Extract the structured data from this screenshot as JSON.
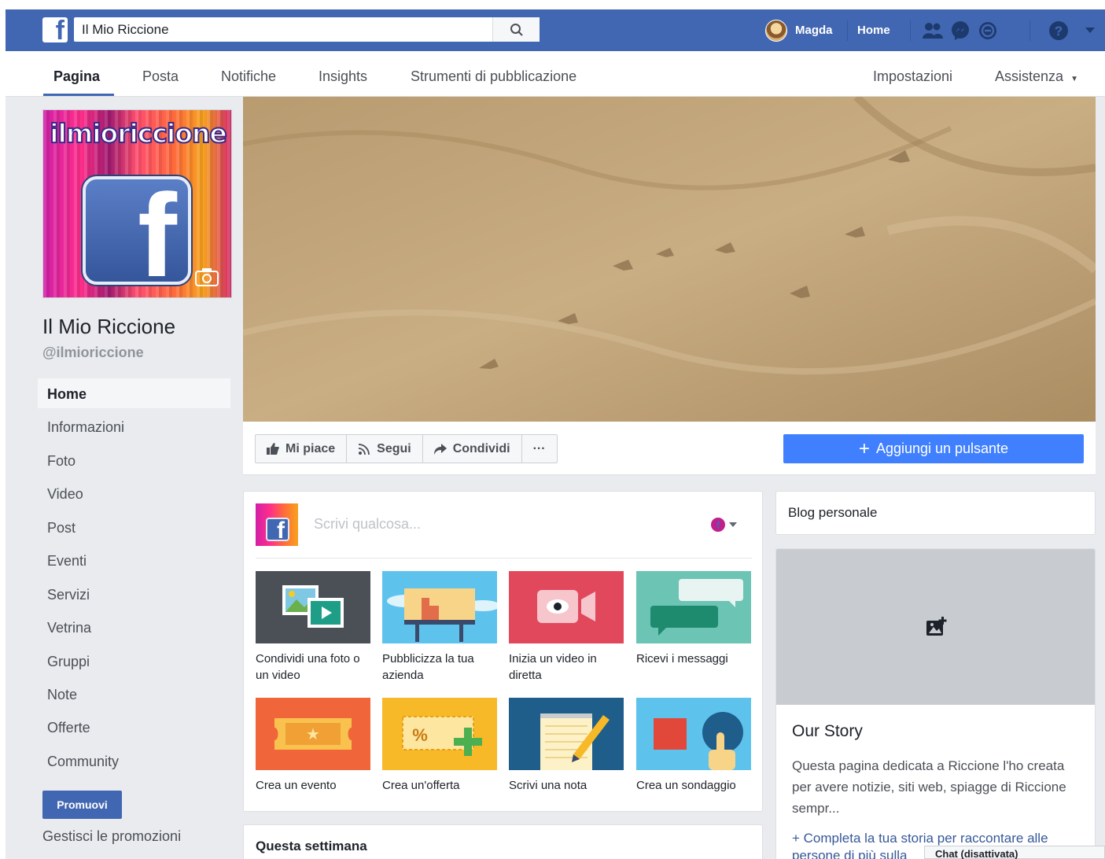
{
  "topbar": {
    "search_value": "Il Mio Riccione",
    "user_name": "Magda",
    "home_label": "Home"
  },
  "subnav": {
    "tabs": [
      "Pagina",
      "Posta",
      "Notifiche",
      "Insights",
      "Strumenti di pubblicazione"
    ],
    "settings_label": "Impostazioni",
    "help_label": "Assistenza"
  },
  "profile": {
    "brand_text": "ilmioriccione",
    "name": "Il Mio Riccione",
    "handle": "@ilmioriccione"
  },
  "leftnav": {
    "items": [
      "Home",
      "Informazioni",
      "Foto",
      "Video",
      "Post",
      "Eventi",
      "Servizi",
      "Vetrina",
      "Gruppi",
      "Note",
      "Offerte",
      "Community"
    ],
    "promote_label": "Promuovi",
    "manage_promotions_label": "Gestisci le promozioni"
  },
  "actions": {
    "like_label": "Mi piace",
    "follow_label": "Segui",
    "share_label": "Condividi",
    "more_label": "···",
    "add_button_label": "Aggiungi un pulsante"
  },
  "composer": {
    "placeholder": "Scrivi qualcosa...",
    "tiles": [
      {
        "label": "Condividi una foto o un video"
      },
      {
        "label": "Pubblicizza la tua azienda"
      },
      {
        "label": "Inizia un video in diretta"
      },
      {
        "label": "Ricevi i messaggi"
      },
      {
        "label": "Crea un evento"
      },
      {
        "label": "Crea un'offerta"
      },
      {
        "label": "Scrivi una nota"
      },
      {
        "label": "Crea un sondaggio"
      }
    ]
  },
  "this_week": {
    "title": "Questa settimana"
  },
  "right": {
    "blog_title": "Blog personale",
    "story_title": "Our Story",
    "story_text": "Questa pagina dedicata a Riccione l'ho creata per avere notizie, siti web, spiagge di Riccione sempr...",
    "story_link": "+ Completa la tua storia per raccontare alle persone di più sulla"
  },
  "chat": {
    "label": "Chat (disattivata)"
  },
  "colors": {
    "brand": "#4267b2",
    "accent": "#4080ff",
    "background": "#e9ebee"
  }
}
